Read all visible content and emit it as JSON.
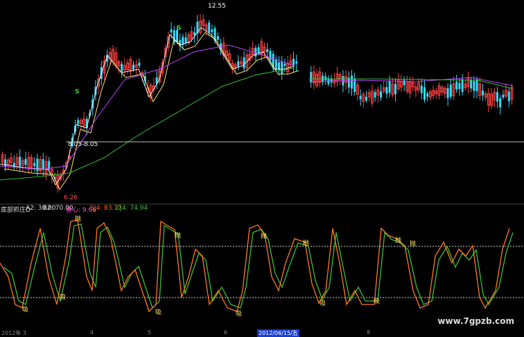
{
  "price": {
    "high_label": "12.55",
    "low_label": "6.26",
    "level_label": "8.05-8.05"
  },
  "indicator": {
    "name": "底部抓庄D",
    "a2": "A2: 30.00",
    "b2": "B2: 70.00",
    "zx": "重心: 9.66",
    "sj": "SJ4: 83.77",
    "zj": "ZJ4: 74.94"
  },
  "signals": {
    "buy": "S",
    "sell_tag": "抛",
    "buy_tag": "吸"
  },
  "axis": {
    "start": "2012年 3",
    "m4": "4",
    "m5": "5",
    "m6": "6",
    "cursor_date": "2012/06/15/五",
    "m7": "7",
    "m8": "8"
  },
  "watermark": "www.7gpzb.com",
  "colors": {
    "up": "#ff4040",
    "down": "#33ddff",
    "ma_white": "#eeeeee",
    "ma_yellow": "#ffe566",
    "ma_magenta": "#c040ff",
    "ma_green": "#33c033",
    "k_line": "#ff7a20",
    "d_line": "#39c035",
    "dash": "#dddddd",
    "signal_s": "#33dd33"
  }
}
